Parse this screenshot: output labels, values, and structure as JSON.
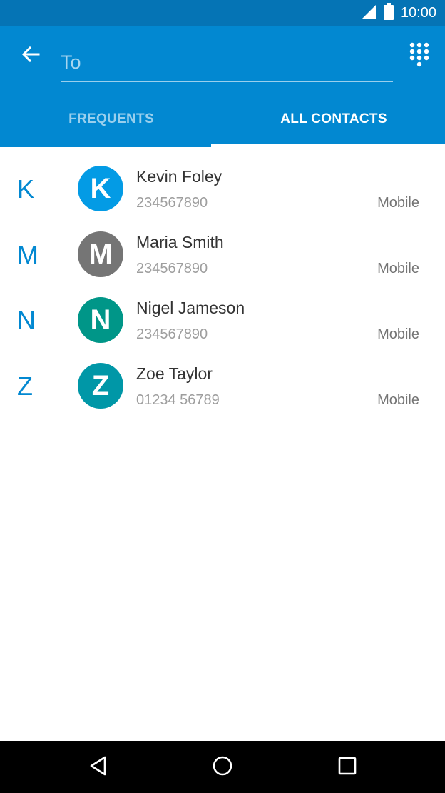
{
  "status_bar": {
    "time": "10:00",
    "signal_icon": "signal-icon",
    "battery_icon": "battery-icon"
  },
  "header": {
    "back_icon": "arrow-back-icon",
    "to_placeholder": "To",
    "to_value": "",
    "dialpad_icon": "dialpad-icon"
  },
  "tabs": [
    {
      "label": "FREQUENTS",
      "active": false
    },
    {
      "label": "ALL CONTACTS",
      "active": true
    }
  ],
  "contacts": [
    {
      "section": "K",
      "initial": "K",
      "name": "Kevin Foley",
      "number": "234567890",
      "type": "Mobile",
      "avatar_color": "#039be5"
    },
    {
      "section": "M",
      "initial": "M",
      "name": "Maria Smith",
      "number": "234567890",
      "type": "Mobile",
      "avatar_color": "#757575"
    },
    {
      "section": "N",
      "initial": "N",
      "name": "Nigel Jameson",
      "number": "234567890",
      "type": "Mobile",
      "avatar_color": "#009688"
    },
    {
      "section": "Z",
      "initial": "Z",
      "name": "Zoe Taylor",
      "number": "01234 56789",
      "type": "Mobile",
      "avatar_color": "#0097a7"
    }
  ],
  "colors": {
    "status_bar": "#0574b5",
    "app_bar": "#0288d1",
    "accent": "#0288d1"
  },
  "nav_bar": {
    "back_icon": "nav-back-icon",
    "home_icon": "nav-home-icon",
    "recents_icon": "nav-recents-icon"
  }
}
